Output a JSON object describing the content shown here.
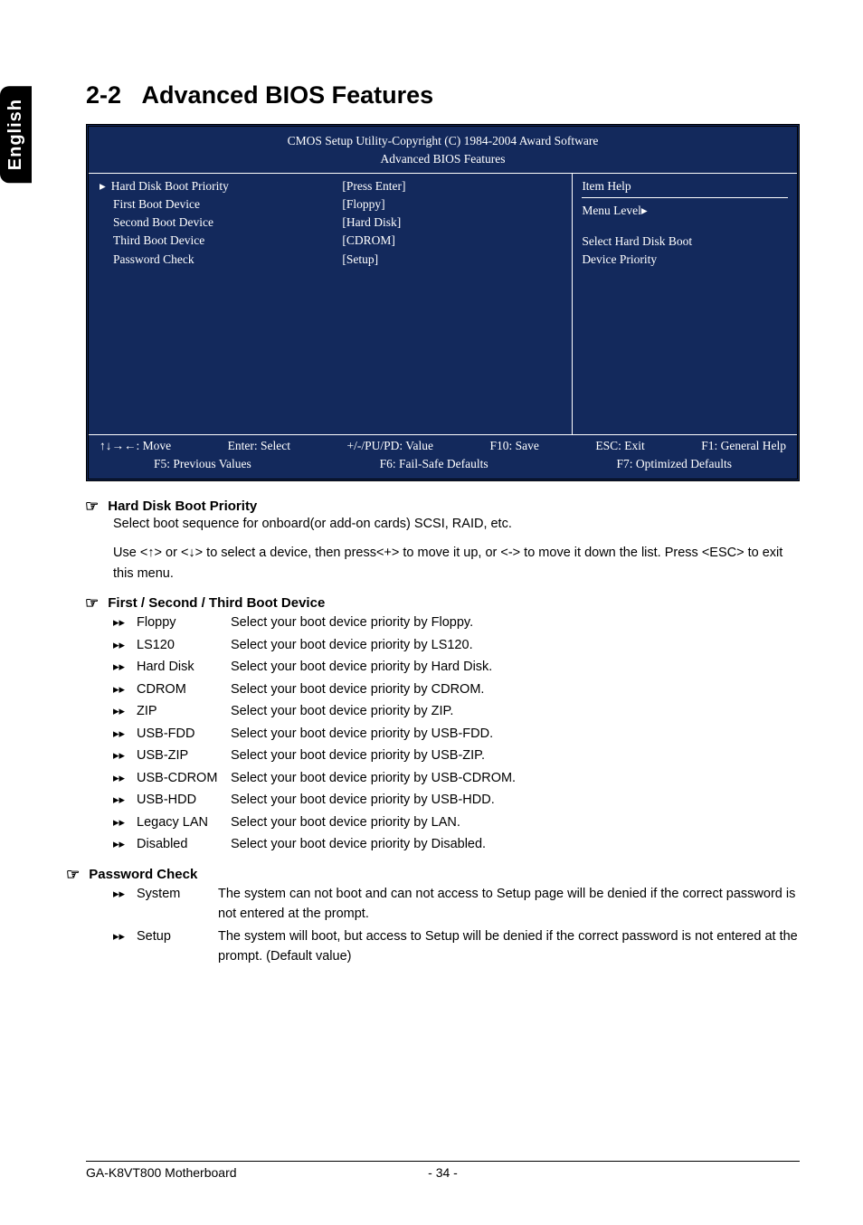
{
  "tab_label": "English",
  "section_number": "2-2",
  "section_title": "Advanced BIOS Features",
  "bios": {
    "header_line1": "CMOS Setup Utility-Copyright (C) 1984-2004 Award Software",
    "header_line2": "Advanced BIOS Features",
    "settings": [
      {
        "label": "Hard Disk Boot Priority",
        "value": "[Press Enter]",
        "arrow": "▸"
      },
      {
        "label": "First Boot Device",
        "value": "[Floppy]",
        "arrow": ""
      },
      {
        "label": "Second Boot Device",
        "value": "[Hard Disk]",
        "arrow": ""
      },
      {
        "label": "Third Boot Device",
        "value": "[CDROM]",
        "arrow": ""
      },
      {
        "label": "Password Check",
        "value": "[Setup]",
        "arrow": ""
      }
    ],
    "help": {
      "title": "Item Help",
      "menu_level_label": "Menu Level",
      "menu_level_arrow": "▸",
      "text1": "Select Hard Disk Boot",
      "text2": "Device Priority"
    },
    "footer": {
      "move": "↑↓→←: Move",
      "select": "Enter: Select",
      "value": "+/-/PU/PD: Value",
      "save": "F10: Save",
      "exit": "ESC: Exit",
      "help": "F1: General Help",
      "prev": "F5: Previous Values",
      "failsafe": "F6: Fail-Safe Defaults",
      "optimized": "F7: Optimized Defaults"
    }
  },
  "items": [
    {
      "title": "Hard Disk Boot Priority",
      "paragraphs": [
        "Select boot sequence for onboard(or add-on cards) SCSI, RAID, etc.",
        "Use <↑> or <↓> to select a device, then press<+> to move it up, or <-> to move it down the list. Press <ESC> to exit this menu."
      ],
      "options": []
    },
    {
      "title": "First / Second / Third Boot Device",
      "paragraphs": [],
      "options": [
        {
          "name": "Floppy",
          "desc": "Select your boot device priority by Floppy."
        },
        {
          "name": "LS120",
          "desc": "Select your boot device priority by LS120."
        },
        {
          "name": "Hard Disk",
          "desc": "Select your boot device priority by Hard Disk."
        },
        {
          "name": "CDROM",
          "desc": "Select your boot device priority by CDROM."
        },
        {
          "name": "ZIP",
          "desc": "Select your boot device priority by ZIP."
        },
        {
          "name": "USB-FDD",
          "desc": "Select your boot device priority by USB-FDD."
        },
        {
          "name": "USB-ZIP",
          "desc": "Select your boot device priority by USB-ZIP."
        },
        {
          "name": "USB-CDROM",
          "desc": "Select your boot device priority by USB-CDROM."
        },
        {
          "name": "USB-HDD",
          "desc": "Select your boot device priority by USB-HDD."
        },
        {
          "name": "Legacy LAN",
          "desc": "Select your boot device priority by LAN."
        },
        {
          "name": "Disabled",
          "desc": "Select your boot device priority by Disabled."
        }
      ]
    },
    {
      "title": "Password Check",
      "paragraphs": [],
      "options": [
        {
          "name": "System",
          "desc": "The system can not boot and can not access to Setup page will be denied if the correct password is not entered at the prompt."
        },
        {
          "name": "Setup",
          "desc": "The system will boot, but access to Setup will be denied if the correct password is not entered at the prompt. (Default value)"
        }
      ]
    }
  ],
  "footer": {
    "left": "GA-K8VT800 Motherboard",
    "center": "- 34 -"
  }
}
